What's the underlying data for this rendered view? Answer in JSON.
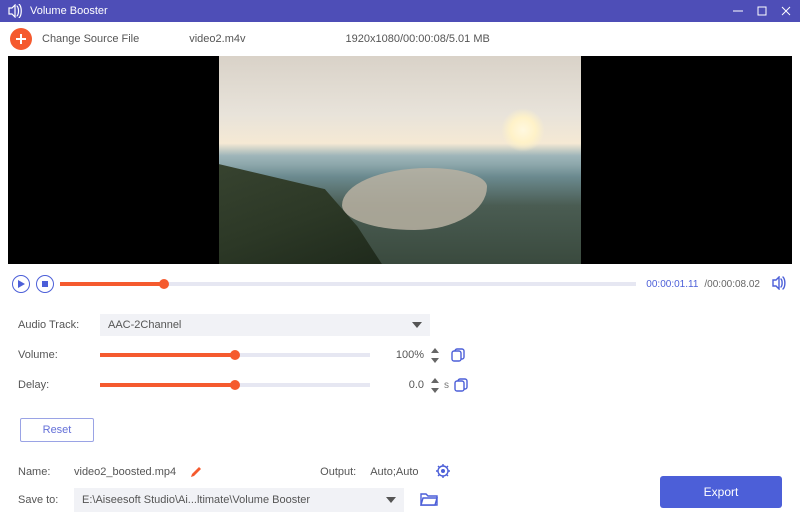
{
  "titlebar": {
    "title": "Volume Booster"
  },
  "toolbar": {
    "change_source_label": "Change Source File",
    "source_name": "video2.m4v",
    "source_info": "1920x1080/00:00:08/5.01 MB"
  },
  "transport": {
    "current_time": "00:00:01.11",
    "duration": "/00:00:08.02",
    "progress_percent": 18
  },
  "audio": {
    "track_label": "Audio Track:",
    "track_value": "AAC-2Channel",
    "volume_label": "Volume:",
    "volume_value": "100%",
    "volume_percent": 50,
    "delay_label": "Delay:",
    "delay_value": "0.0",
    "delay_unit": "s",
    "delay_percent": 50
  },
  "buttons": {
    "reset": "Reset",
    "export": "Export"
  },
  "footer": {
    "name_label": "Name:",
    "name_value": "video2_boosted.mp4",
    "output_label": "Output:",
    "output_value": "Auto;Auto",
    "save_label": "Save to:",
    "save_path": "E:\\Aiseesoft Studio\\Ai...ltimate\\Volume Booster"
  }
}
